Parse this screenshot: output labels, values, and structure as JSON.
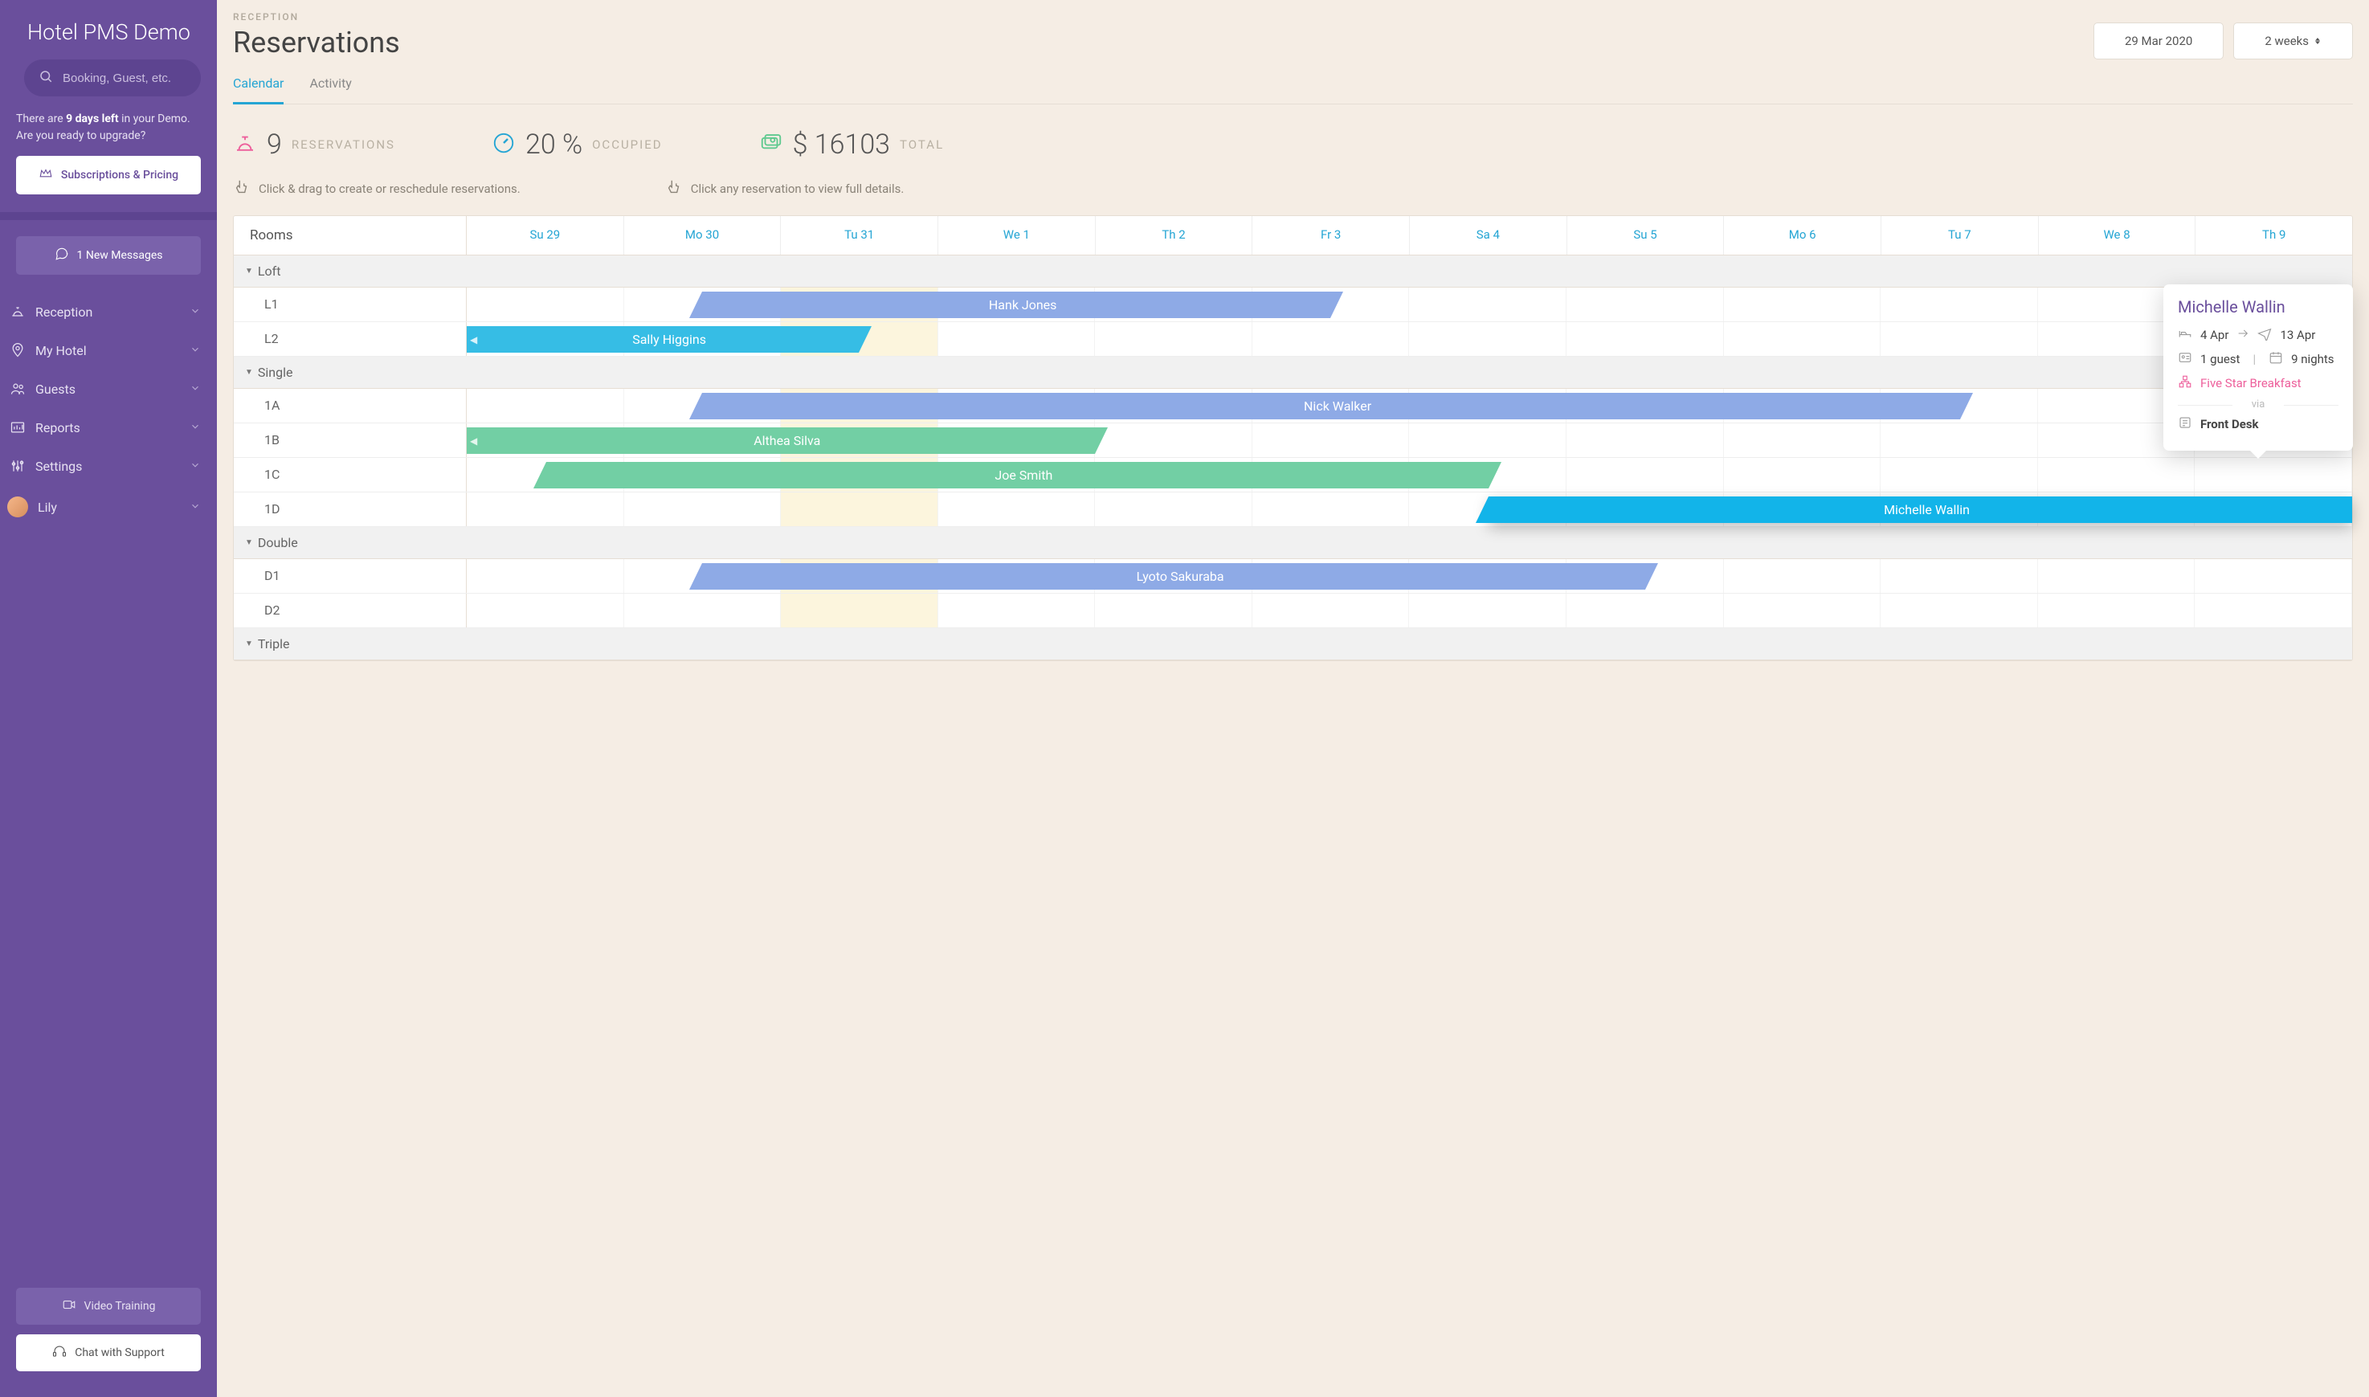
{
  "sidebar": {
    "brand": "Hotel PMS Demo",
    "search_placeholder": "Booking, Guest, etc.",
    "demo_prefix": "There are ",
    "demo_bold": "9 days left",
    "demo_suffix": " in your Demo.",
    "demo_line2": "Are you ready to upgrade?",
    "subscriptions_label": "Subscriptions & Pricing",
    "messages_label": "1 New Messages",
    "nav": [
      {
        "label": "Reception"
      },
      {
        "label": "My Hotel"
      },
      {
        "label": "Guests"
      },
      {
        "label": "Reports"
      },
      {
        "label": "Settings"
      },
      {
        "label": "Lily"
      }
    ],
    "video_training": "Video Training",
    "chat_support": "Chat with Support"
  },
  "header": {
    "breadcrumb": "RECEPTION",
    "title": "Reservations",
    "date_label": "29 Mar 2020",
    "range_label": "2 weeks",
    "tabs": [
      {
        "label": "Calendar",
        "active": true
      },
      {
        "label": "Activity",
        "active": false
      }
    ]
  },
  "stats": {
    "reservations_value": "9",
    "reservations_label": "RESERVATIONS",
    "occupied_value": "20 %",
    "occupied_label": "OCCUPIED",
    "total_value": "$ 16103",
    "total_label": "TOTAL"
  },
  "hints": {
    "create": "Click & drag to create or reschedule reservations.",
    "view": "Click any reservation to view full details."
  },
  "calendar": {
    "rooms_header": "Rooms",
    "days": [
      "Su 29",
      "Mo 30",
      "Tu 31",
      "We 1",
      "Th 2",
      "Fr 3",
      "Sa 4",
      "Su 5",
      "Mo 6",
      "Tu 7",
      "We 8",
      "Th 9"
    ],
    "groups": [
      {
        "name": "Loft",
        "rooms": [
          "L1",
          "L2"
        ]
      },
      {
        "name": "Single",
        "rooms": [
          "1A",
          "1B",
          "1C",
          "1D"
        ]
      },
      {
        "name": "Double",
        "rooms": [
          "D1",
          "D2"
        ]
      },
      {
        "name": "Triple",
        "rooms": []
      }
    ],
    "reservations": {
      "L1": {
        "guest": "Hank Jones",
        "color": "blue",
        "start_pct": 12.5,
        "width_pct": 33.3,
        "overflow_left": false
      },
      "L2": {
        "guest": "Sally Higgins",
        "color": "cyan",
        "start_pct": 0,
        "width_pct": 20.8,
        "overflow_left": true
      },
      "1A": {
        "guest": "Nick Walker",
        "color": "blue",
        "start_pct": 12.5,
        "width_pct": 66.7,
        "overflow_left": false
      },
      "1B": {
        "guest": "Althea Silva",
        "color": "green",
        "start_pct": 0,
        "width_pct": 33.3,
        "overflow_left": true
      },
      "1C": {
        "guest": "Joe Smith",
        "color": "green",
        "start_pct": 4.2,
        "width_pct": 50.0,
        "overflow_left": false
      },
      "1D": {
        "guest": "Michelle Wallin",
        "color": "bright",
        "start_pct": 54.2,
        "width_pct": 45.8,
        "overflow_left": false
      },
      "D1": {
        "guest": "Lyoto Sakuraba",
        "color": "blue",
        "start_pct": 12.5,
        "width_pct": 50.0,
        "overflow_left": false
      }
    }
  },
  "popover": {
    "guest": "Michelle Wallin",
    "checkin": "4 Apr",
    "checkout": "13 Apr",
    "guests": "1 guest",
    "nights": "9 nights",
    "plan": "Five Star Breakfast",
    "via_label": "via",
    "source": "Front Desk"
  },
  "colors": {
    "sidebar": "#6a4f9c",
    "accent": "#25a5d4",
    "pink": "#ed5f9b",
    "green_stat": "#5fc98f"
  }
}
